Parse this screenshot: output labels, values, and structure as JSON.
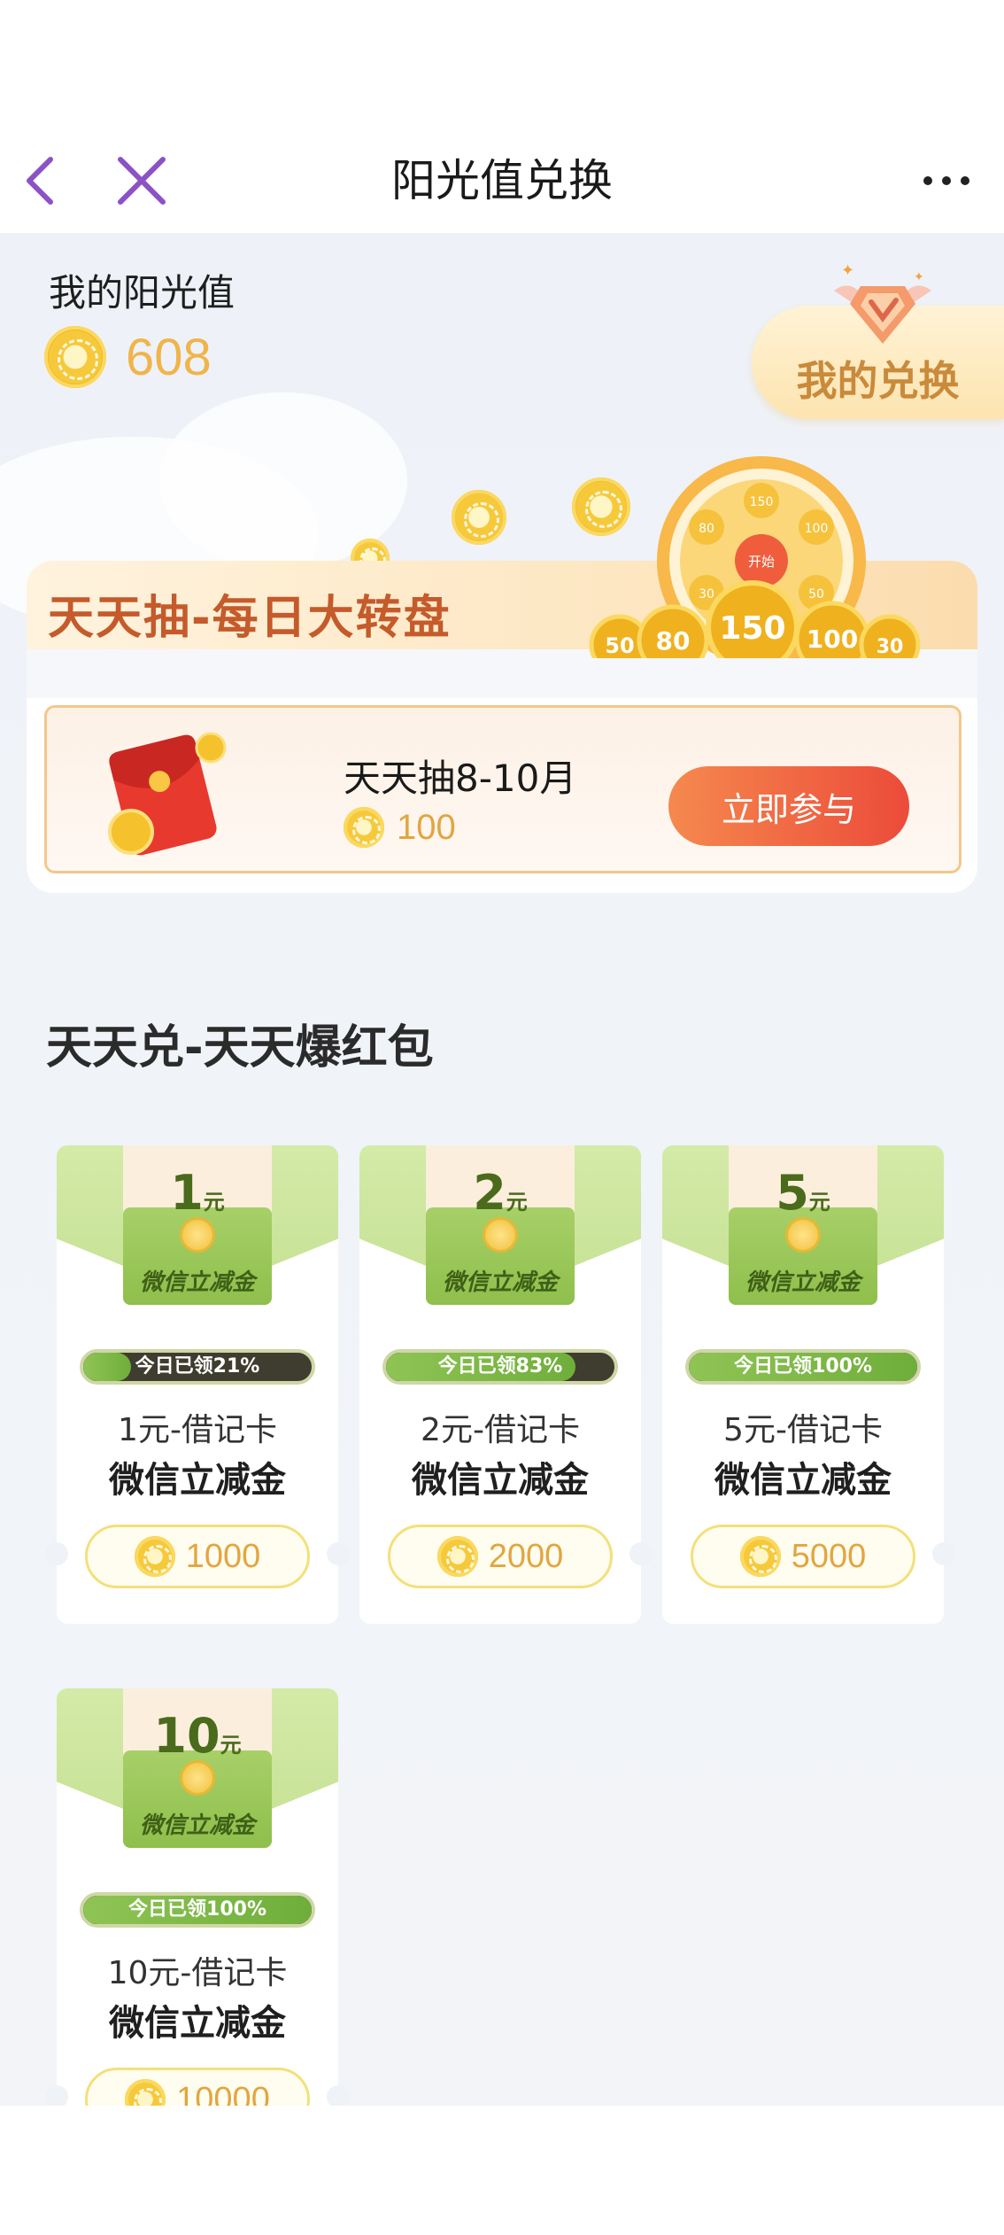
{
  "navbar": {
    "title": "阳光值兑换",
    "accent_color": "#8b52c7"
  },
  "balance": {
    "label": "我的阳光值",
    "value": "608"
  },
  "my_exchange": {
    "label": "我的兑换"
  },
  "wheel": {
    "title": "天天抽-每日大转盘",
    "wheel_numbers": [
      "150",
      "100",
      "50",
      "80",
      "30",
      "开始"
    ],
    "lottery": {
      "name": "天天抽8-10月",
      "cost": "100",
      "button": "立即参与"
    }
  },
  "exchange_section": {
    "title": "天天兑-天天爆红包",
    "unit": "元",
    "envelope_label": "微信立减金",
    "items": [
      {
        "amount": "1",
        "claimed": "今日已领21%",
        "claimed_pct": 21,
        "type": "1元-借记卡",
        "name": "微信立减金",
        "price": "1000"
      },
      {
        "amount": "2",
        "claimed": "今日已领83%",
        "claimed_pct": 83,
        "type": "2元-借记卡",
        "name": "微信立减金",
        "price": "2000"
      },
      {
        "amount": "5",
        "claimed": "今日已领100%",
        "claimed_pct": 100,
        "type": "5元-借记卡",
        "name": "微信立减金",
        "price": "5000"
      },
      {
        "amount": "10",
        "claimed": "今日已领100%",
        "claimed_pct": 100,
        "type": "10元-借记卡",
        "name": "微信立减金",
        "price": "10000"
      }
    ]
  }
}
